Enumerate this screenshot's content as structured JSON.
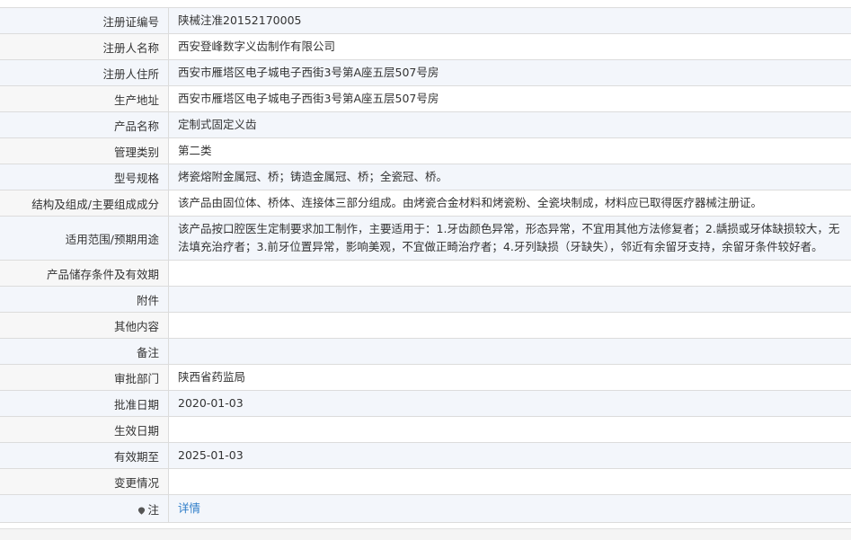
{
  "rows": [
    {
      "label": "注册证编号",
      "value": "陕械注准20152170005"
    },
    {
      "label": "注册人名称",
      "value": "西安登峰数字义齿制作有限公司"
    },
    {
      "label": "注册人住所",
      "value": "西安市雁塔区电子城电子西街3号第A座五层507号房"
    },
    {
      "label": "生产地址",
      "value": "西安市雁塔区电子城电子西街3号第A座五层507号房"
    },
    {
      "label": "产品名称",
      "value": "定制式固定义齿"
    },
    {
      "label": "管理类别",
      "value": "第二类"
    },
    {
      "label": "型号规格",
      "value": "烤瓷熔附金属冠、桥；铸造金属冠、桥；全瓷冠、桥。"
    },
    {
      "label": "结构及组成/主要组成成分",
      "value": "该产品由固位体、桥体、连接体三部分组成。由烤瓷合金材料和烤瓷粉、全瓷块制成，材料应已取得医疗器械注册证。"
    },
    {
      "label": "适用范围/预期用途",
      "value": "该产品按口腔医生定制要求加工制作，主要适用于：1.牙齿颜色异常，形态异常，不宜用其他方法修复者；2.龋损或牙体缺损较大，无法填充治疗者；3.前牙位置异常，影响美观，不宜做正畸治疗者；4.牙列缺损（牙缺失），邻近有余留牙支持，余留牙条件较好者。"
    },
    {
      "label": "产品储存条件及有效期",
      "value": ""
    },
    {
      "label": "附件",
      "value": ""
    },
    {
      "label": "其他内容",
      "value": ""
    },
    {
      "label": "备注",
      "value": ""
    },
    {
      "label": "审批部门",
      "value": "陕西省药监局"
    },
    {
      "label": "批准日期",
      "value": "2020-01-03"
    },
    {
      "label": "生效日期",
      "value": ""
    },
    {
      "label": "有效期至",
      "value": "2025-01-03"
    },
    {
      "label": "变更情况",
      "value": ""
    },
    {
      "label": "注",
      "value": "详情"
    }
  ],
  "icons": {
    "note": "map-pin-icon"
  }
}
